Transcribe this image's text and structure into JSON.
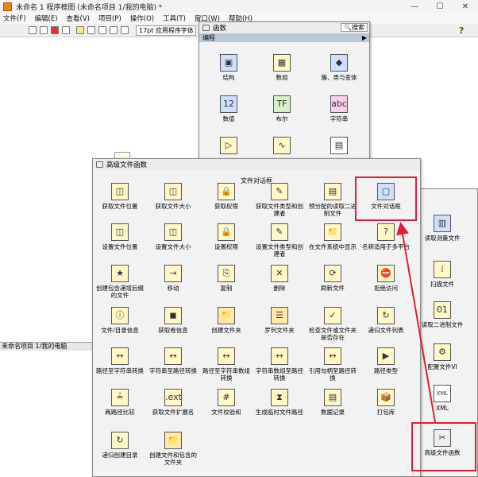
{
  "window": {
    "title": "未命名 1 程序框图 (未命名项目 1/我的电脑) *",
    "controls": [
      "—",
      "☐",
      "✕"
    ]
  },
  "menu": [
    "文件(F)",
    "编辑(E)",
    "查看(V)",
    "项目(P)",
    "操作(O)",
    "工具(T)",
    "窗口(W)",
    "帮助(H)"
  ],
  "toolbar": {
    "font": "17pt 应用程序字体"
  },
  "statusbar": {
    "project": "未命名项目 1/我的电脑"
  },
  "functions_palette": {
    "title": "函数",
    "search_label": "搜索",
    "category": "编程",
    "items": [
      {
        "label": "结构",
        "icon": "structure-icon"
      },
      {
        "label": "数组",
        "icon": "array-icon"
      },
      {
        "label": "簇、类与变体",
        "icon": "cluster-icon"
      },
      {
        "label": "数值",
        "icon": "numeric-icon"
      },
      {
        "label": "布尔",
        "icon": "boolean-icon"
      },
      {
        "label": "字符串",
        "icon": "string-icon"
      }
    ]
  },
  "side_palette": {
    "items": [
      {
        "label": "读取测量文件",
        "icon": "read-measurement-icon"
      },
      {
        "label": "扫描文件",
        "icon": "scan-file-icon"
      },
      {
        "label": "读取二进制文件",
        "icon": "read-binary-icon"
      },
      {
        "label": "配置文件VI",
        "icon": "config-file-icon"
      },
      {
        "label": "XML",
        "icon": "xml-icon"
      },
      {
        "label": "高级文件函数",
        "icon": "advanced-file-icon"
      }
    ]
  },
  "advanced_palette": {
    "title": "高级文件函数",
    "section": "文件对话框",
    "items": [
      {
        "label": "获取文件位置",
        "icon": "get-file-position-icon"
      },
      {
        "label": "获取文件大小",
        "icon": "get-file-size-icon"
      },
      {
        "label": "获取权限",
        "icon": "get-permissions-icon"
      },
      {
        "label": "获取文件类型和创建者",
        "icon": "get-file-type-icon"
      },
      {
        "label": "预分配的读取二进制文件",
        "icon": "prealloc-read-icon"
      },
      {
        "label": "文件对话框",
        "icon": "file-dialog-icon"
      },
      {
        "label": "设置文件位置",
        "icon": "set-file-position-icon"
      },
      {
        "label": "设置文件大小",
        "icon": "set-file-size-icon"
      },
      {
        "label": "设置权限",
        "icon": "set-permissions-icon"
      },
      {
        "label": "设置文件类型和创建者",
        "icon": "set-file-type-icon"
      },
      {
        "label": "在文件系统中显示",
        "icon": "show-in-fs-icon"
      },
      {
        "label": "名称适用于多平台",
        "icon": "name-multiplatform-icon"
      },
      {
        "label": "创建包含递增后缀的文件",
        "icon": "create-incrementing-icon"
      },
      {
        "label": "移动",
        "icon": "move-icon"
      },
      {
        "label": "复制",
        "icon": "copy-icon"
      },
      {
        "label": "删除",
        "icon": "delete-icon"
      },
      {
        "label": "刷新文件",
        "icon": "flush-file-icon"
      },
      {
        "label": "拒绝访问",
        "icon": "deny-access-icon"
      },
      {
        "label": "文件/目录信息",
        "icon": "file-info-icon"
      },
      {
        "label": "获取卷信息",
        "icon": "volume-info-icon"
      },
      {
        "label": "创建文件夹",
        "icon": "create-folder-icon"
      },
      {
        "label": "罗列文件夹",
        "icon": "list-folder-icon"
      },
      {
        "label": "检查文件或文件夹是否存在",
        "icon": "check-exists-icon"
      },
      {
        "label": "递归文件列表",
        "icon": "recursive-list-icon"
      },
      {
        "label": "路径至字符串转换",
        "icon": "path-to-string-icon"
      },
      {
        "label": "字符串至路径转换",
        "icon": "string-to-path-icon"
      },
      {
        "label": "路径至字符串数组转换",
        "icon": "path-to-array-icon"
      },
      {
        "label": "字符串数组至路径转换",
        "icon": "array-to-path-icon"
      },
      {
        "label": "引用句柄至路径转换",
        "icon": "refnum-to-path-icon"
      },
      {
        "label": "路径类型",
        "icon": "path-type-icon"
      },
      {
        "label": "两路径比较",
        "icon": "compare-paths-icon"
      },
      {
        "label": "获取文件扩展名",
        "icon": "get-extension-icon"
      },
      {
        "label": "文件校验和",
        "icon": "file-checksum-icon"
      },
      {
        "label": "生成临时文件路径",
        "icon": "temp-path-icon"
      },
      {
        "label": "数据记录",
        "icon": "datalog-icon"
      },
      {
        "label": "打包库",
        "icon": "packed-library-icon"
      },
      {
        "label": "递归创建目录",
        "icon": "recursive-mkdir-icon"
      },
      {
        "label": "创建文件和包含的文件夹",
        "icon": "create-file-folder-icon"
      }
    ]
  }
}
